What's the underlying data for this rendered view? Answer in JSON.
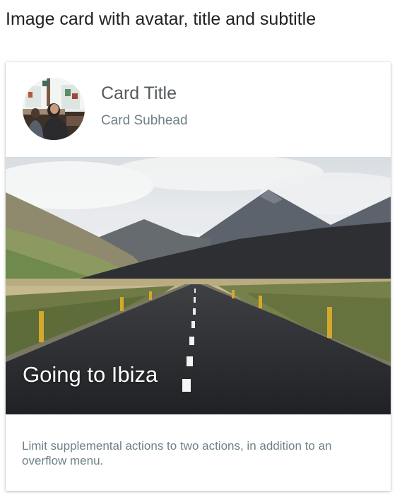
{
  "page": {
    "heading": "Image card with avatar, title and subtitle"
  },
  "card": {
    "title": "Card Title",
    "subhead": "Card Subhead",
    "media_caption": "Going to Ibiza",
    "supporting_text": "Limit supplemental actions to two actions, in addition to an overflow menu."
  },
  "colors": {
    "title_text": "#555a5e",
    "secondary_text": "#6f8187",
    "caption_text": "#ffffff"
  }
}
